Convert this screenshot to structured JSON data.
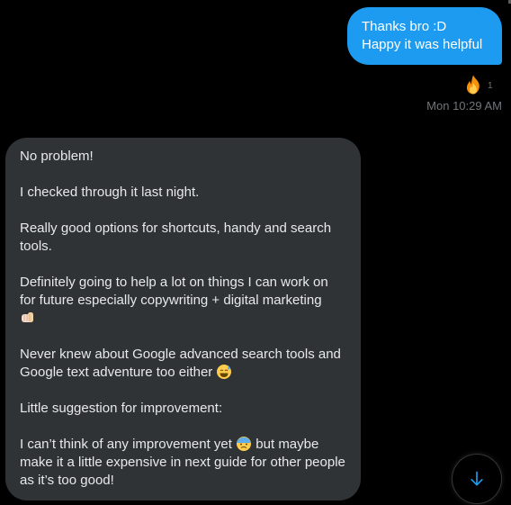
{
  "colors": {
    "background": "#000000",
    "sent_bubble": "#1d9bf0",
    "received_bubble": "#2f3336",
    "muted_text": "#71767b",
    "accent": "#1d9bf0"
  },
  "sent_message": {
    "line1": "Thanks bro :D",
    "line2": "Happy it was helpful"
  },
  "reaction": {
    "emoji": "fire-emoji",
    "count": "1"
  },
  "timestamp": "Mon 10:29 AM",
  "received_message": {
    "p1": "No problem!",
    "p2": "I checked through it last night.",
    "p3": "Really good options for shortcuts, handy and search tools.",
    "p4": "Definitely going to help a lot on things I can work on for future especially copywriting + digital marketing",
    "p4_emoji": "fist-bump-emoji",
    "p5": "Never knew about Google advanced search tools and Google text adventure too either",
    "p5_emoji": "grinning-sweat-emoji",
    "p6": "Little suggestion for improvement:",
    "p7a": "I can’t think of any improvement yet",
    "p7_emoji": "cold-sweat-emoji",
    "p7b": "but maybe make it a little expensive in next guide for other people as it’s too good!"
  },
  "scroll_button_icon": "arrow-down-icon"
}
